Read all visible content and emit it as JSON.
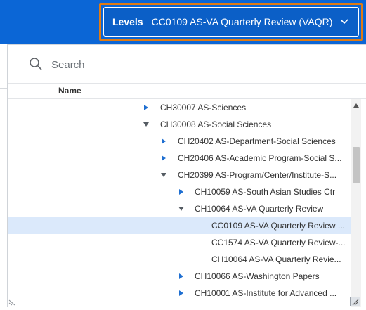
{
  "header": {
    "level_label": "Levels",
    "level_value": "CC0109 AS-VA Quarterly Review (VAQR)",
    "accent_color": "#e07b14",
    "brand_color": "#0b66d6"
  },
  "search": {
    "placeholder": "Search",
    "icon": "search-icon"
  },
  "table": {
    "column_header": "Name"
  },
  "tree": {
    "rows": [
      {
        "label": "CH30007 AS-Sciences",
        "toggle": "collapsed"
      },
      {
        "label": "CH30008 AS-Social Sciences",
        "toggle": "expanded"
      },
      {
        "label": "CH20402 AS-Department-Social Sciences",
        "toggle": "collapsed"
      },
      {
        "label": "CH20406 AS-Academic Program-Social S...",
        "toggle": "collapsed"
      },
      {
        "label": "CH20399 AS-Program/Center/Institute-S...",
        "toggle": "expanded"
      },
      {
        "label": "CH10059 AS-South Asian Studies Ctr",
        "toggle": "collapsed"
      },
      {
        "label": "CH10064 AS-VA Quarterly Review",
        "toggle": "expanded"
      },
      {
        "label": "CC0109 AS-VA Quarterly Review ...",
        "toggle": "none",
        "selected": true
      },
      {
        "label": "CC1574 AS-VA Quarterly Review-...",
        "toggle": "none"
      },
      {
        "label": "CH10064 AS-VA Quarterly Revie...",
        "toggle": "none"
      },
      {
        "label": "CH10066 AS-Washington Papers",
        "toggle": "collapsed"
      },
      {
        "label": "CH10001 AS-Institute for Advanced ...",
        "toggle": "collapsed"
      }
    ]
  }
}
